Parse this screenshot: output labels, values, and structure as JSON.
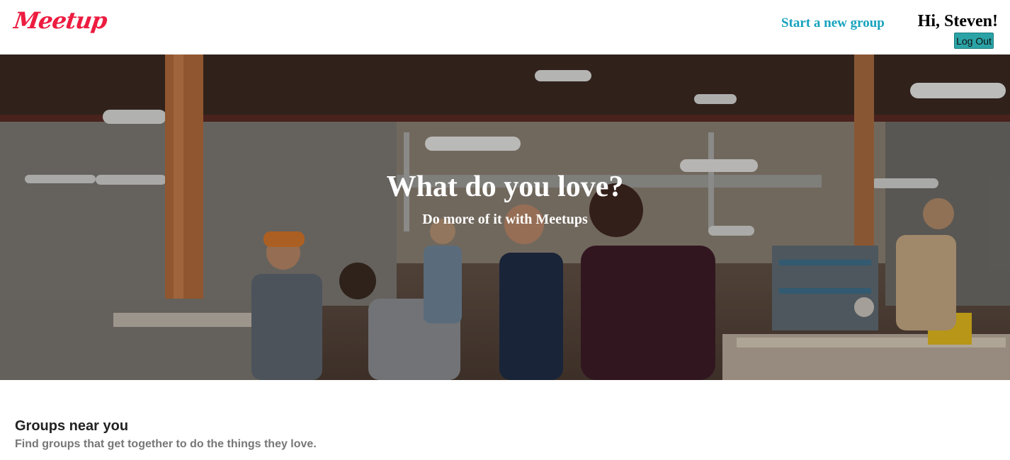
{
  "header": {
    "logo": "Meetup",
    "start_group": "Start a new group",
    "greeting": "Hi, Steven!",
    "logout": "Log Out"
  },
  "hero": {
    "title": "What do you love?",
    "subtitle": "Do more of it with Meetups"
  },
  "groups": {
    "title": "Groups near you",
    "subtitle": "Find groups that get together to do the things they love."
  },
  "colors": {
    "brand": "#ed1c40",
    "link": "#16a2bd",
    "logout_bg": "#2ba3a6"
  }
}
